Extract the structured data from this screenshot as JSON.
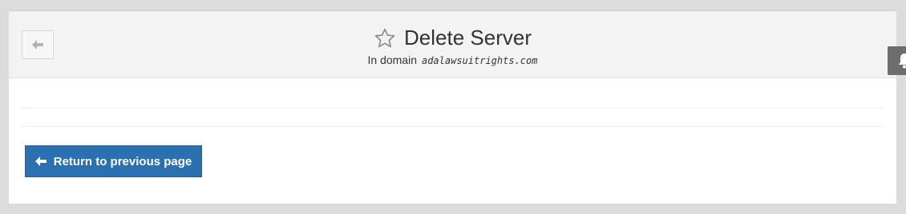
{
  "header": {
    "title": "Delete Server",
    "subtitle_prefix": "In domain",
    "domain": "adalawsuitrights.com"
  },
  "actions": {
    "back_icon": "arrow-left-icon",
    "favorite_icon": "star-outline-icon",
    "return_label": "Return to previous page",
    "return_icon": "arrow-left-icon",
    "notification_icon": "bell-icon"
  },
  "colors": {
    "primary_button": "#2b70b1",
    "header_bg": "#f3f3f3",
    "page_bg": "#dcdcdc",
    "notify_tab": "#6d6d6d"
  }
}
